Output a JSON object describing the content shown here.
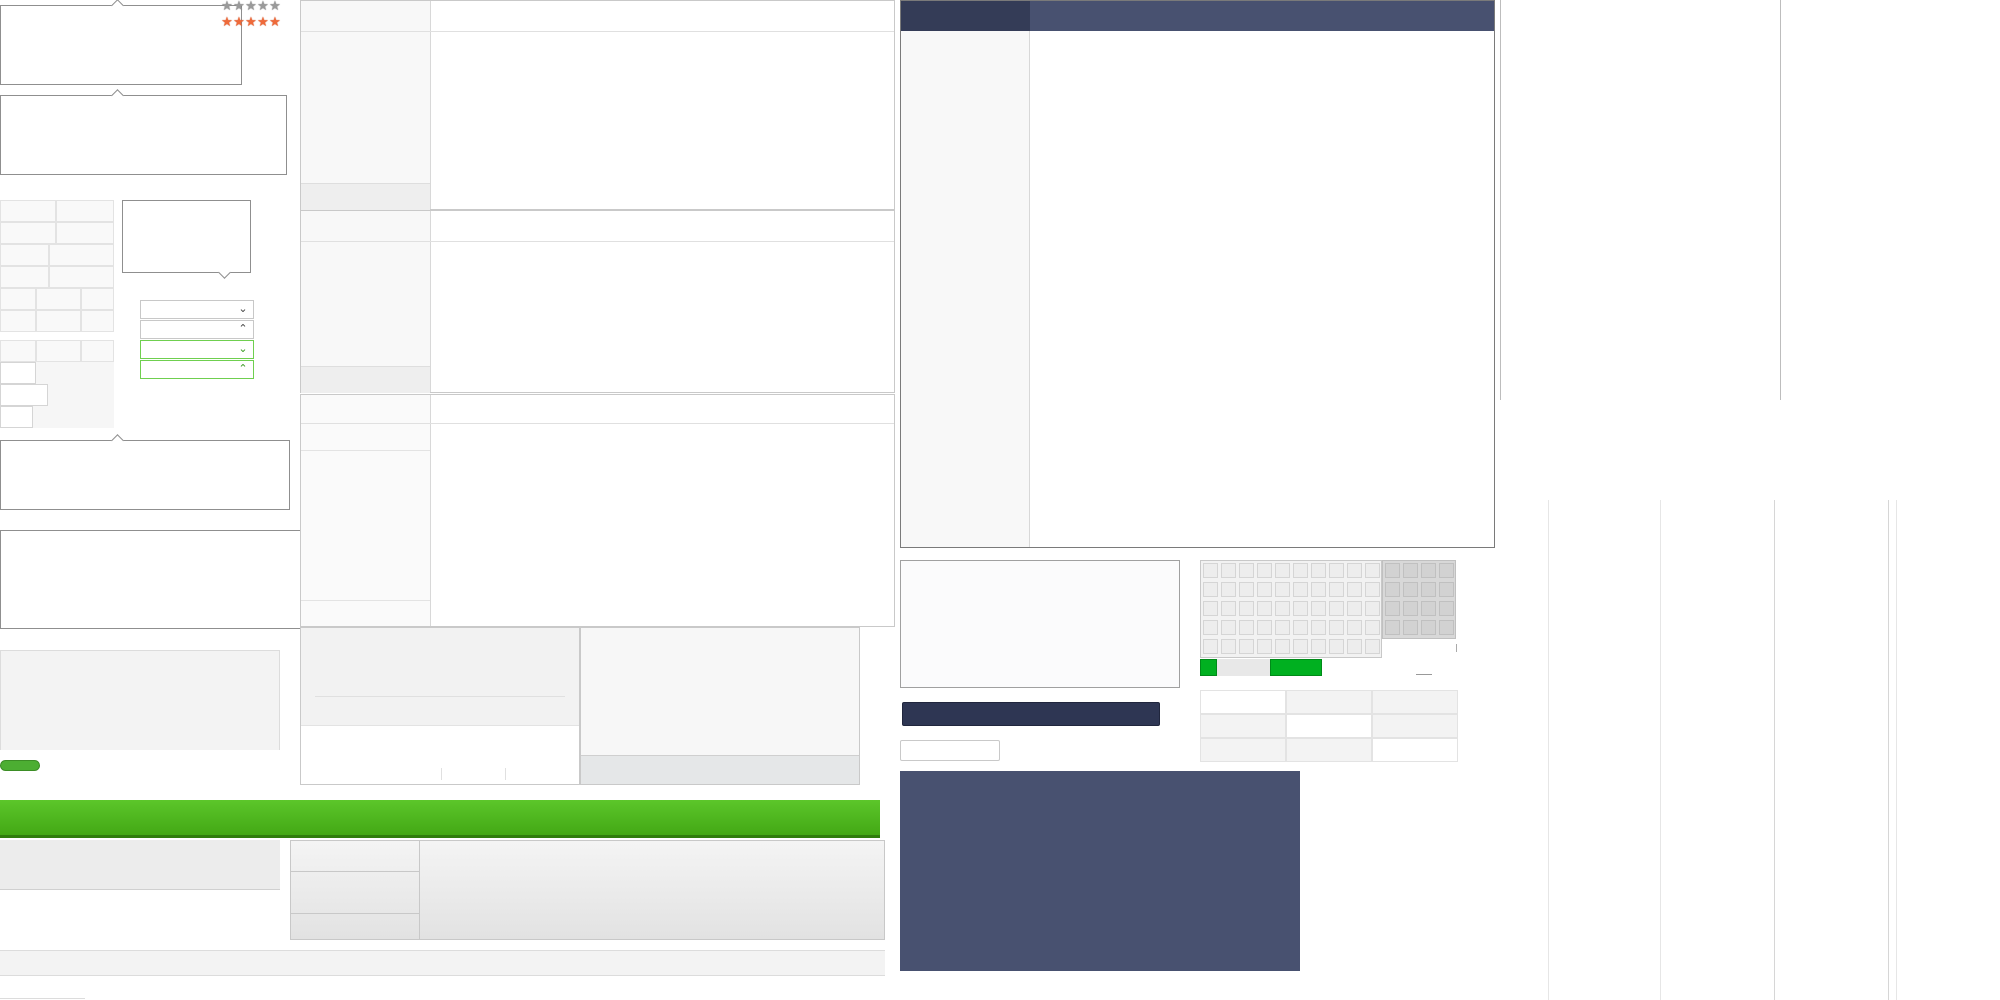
{
  "app": {
    "title": ""
  },
  "ratings": [
    {
      "value": 0,
      "max": 5,
      "color": "#9a9a9a"
    },
    {
      "value": 5,
      "max": 5,
      "color": "#ef6a3a"
    }
  ],
  "selects": [
    {
      "value": "",
      "state": "closed"
    },
    {
      "value": "",
      "state": "open"
    },
    {
      "value": "",
      "state": "closed-valid"
    },
    {
      "value": "",
      "state": "open-valid"
    }
  ],
  "colors": {
    "accent_green": "#4cae32",
    "navy": "#485170",
    "navy_dark": "#343c57",
    "calendar_green": "#00b020"
  },
  "icons": {
    "star": "star-icon",
    "chevron_down": "chevron-down-icon",
    "chevron_up": "chevron-up-icon"
  }
}
